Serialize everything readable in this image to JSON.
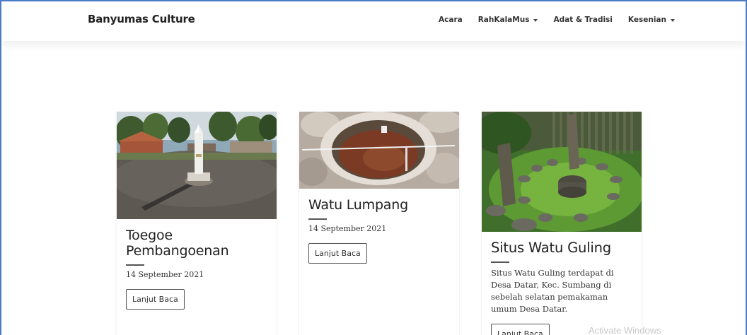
{
  "navbar": {
    "brand": "Banyumas Culture",
    "items": [
      {
        "label": "Acara",
        "dropdown": false
      },
      {
        "label": "RahKalaMus",
        "dropdown": true
      },
      {
        "label": "Adat & Tradisi",
        "dropdown": false
      },
      {
        "label": "Kesenian",
        "dropdown": true
      }
    ]
  },
  "cards": [
    {
      "title_line1": "Toegoe",
      "title_line2": "Pembangoenan",
      "date": "14 September 2021",
      "button": "Lanjut Baca",
      "image_icon": "monument-photo"
    },
    {
      "title": "Watu Lumpang",
      "date": "14 September 2021",
      "button": "Lanjut Baca",
      "image_icon": "stone-mortar-photo"
    },
    {
      "title": "Situs Watu Guling",
      "description": "Situs Watu Guling terdapat di Desa Datar, Kec. Sumbang di sebelah selatan pemakaman umum Desa Datar.",
      "button": "Lanjut Baca",
      "image_icon": "megalith-site-photo"
    }
  ],
  "watermark": "Activate Windows",
  "colors": {
    "frame_border": "#4a7bc4",
    "text": "#222222",
    "button_border": "#555555"
  }
}
